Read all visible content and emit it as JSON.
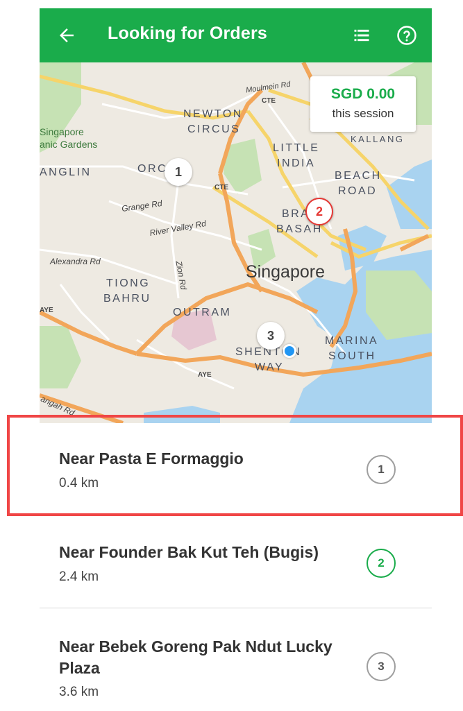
{
  "appbar": {
    "title": "Looking for Orders",
    "back_icon": "arrow-left-icon",
    "list_icon": "list-icon",
    "help_icon": "help-circle-icon"
  },
  "earnings": {
    "amount": "SGD 0.00",
    "label": "this session"
  },
  "map": {
    "city": "Singapore",
    "labels": {
      "newton": "NEWTON",
      "circus": "CIRCUS",
      "little": "LITTLE",
      "india": "INDIA",
      "beach": "BEACH",
      "road": "ROAD",
      "bra": "BRA",
      "basah": "BASAH",
      "tiong": "TIONG",
      "bahru": "BAHRU",
      "outram": "OUTRAM",
      "marina": "MARINA",
      "south": "SOUTH",
      "shenton": "SHENTON",
      "way": "WAY",
      "tanglin": "ANGLIN",
      "orchard": "ORC   RD",
      "kallang": "KALLANG",
      "gardens1": "Singapore",
      "gardens2": "anic Gardens",
      "moulmein": "Moulmein Rd",
      "cte1": "CTE",
      "cte2": "CTE",
      "grange": "Grange Rd",
      "river_valley": "River Valley Rd",
      "alexandra": "Alexandra Rd",
      "zion": "Zion Rd",
      "aye1": "AYE",
      "aye2": "AYE",
      "jalan": "angah Rd"
    },
    "pins": [
      "3",
      "2",
      "1"
    ]
  },
  "orders": [
    {
      "name": "Near Pasta E Formaggio",
      "distance": "0.4 km",
      "number": "1"
    },
    {
      "name": "Near Founder Bak Kut Teh (Bugis)",
      "distance": "2.4 km",
      "number": "2"
    },
    {
      "name": "Near Bebek Goreng Pak Ndut Lucky Plaza",
      "distance": "3.6 km",
      "number": "3"
    }
  ],
  "colors": {
    "brand_green": "#1aac4b",
    "active_red": "#e53935",
    "highlight_red": "#f04646",
    "location_blue": "#2196f3"
  }
}
